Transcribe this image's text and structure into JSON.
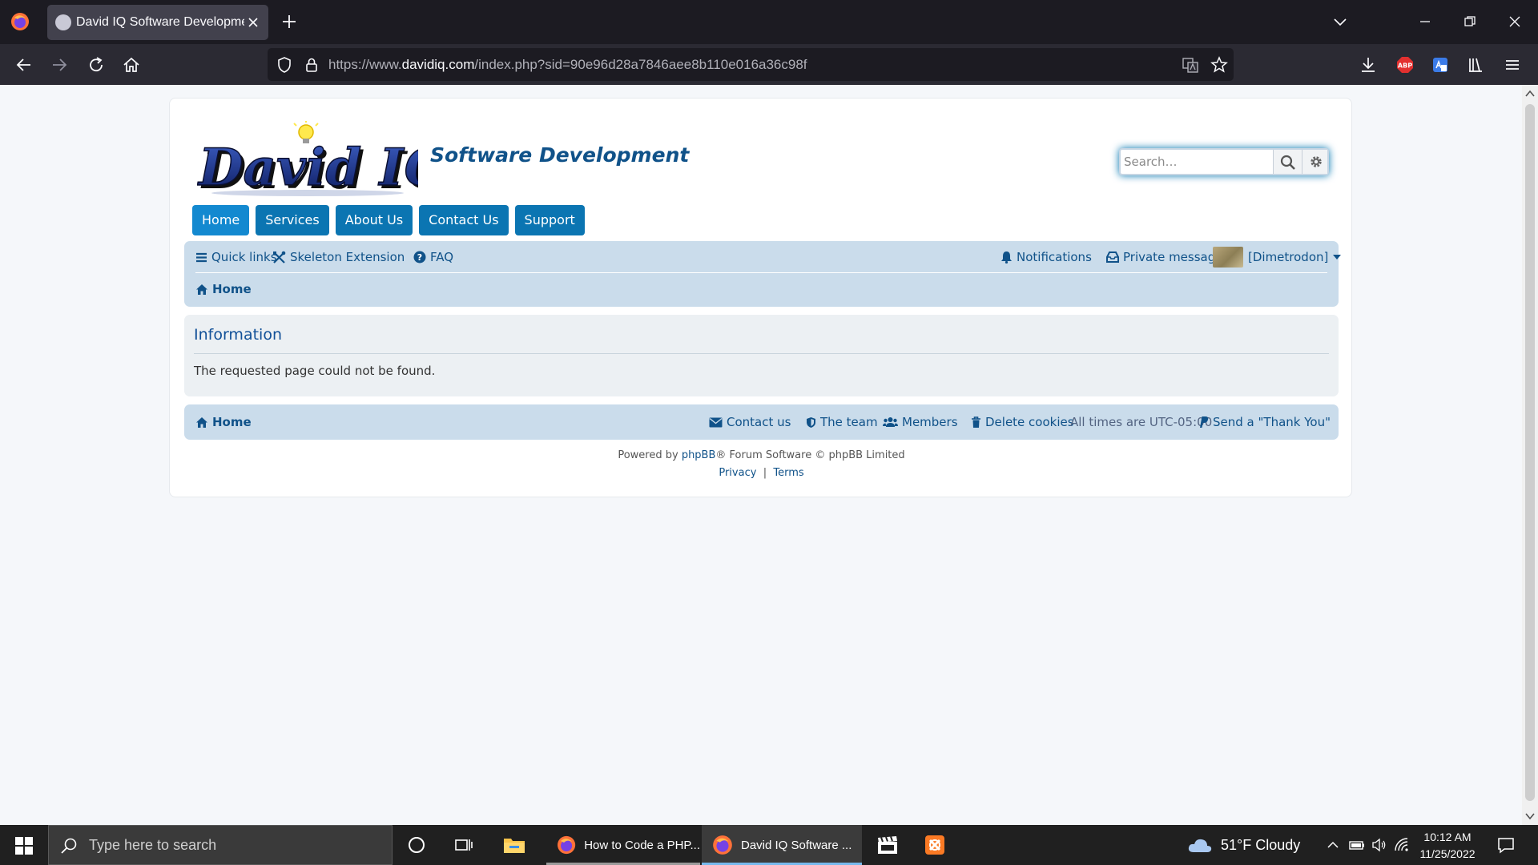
{
  "browser": {
    "tab_title": "David IQ Software Development",
    "url_prefix": "https://www.",
    "url_host": "davidiq.com",
    "url_path": "/index.php?sid=90e96d28a7846aee8b110e016a36c98f",
    "adblock_label": "ABP"
  },
  "site": {
    "logo_text": "David IQ",
    "tagline": "Software Development",
    "search_placeholder": "Search…"
  },
  "mainnav": [
    "Home",
    "Services",
    "About Us",
    "Contact Us",
    "Support"
  ],
  "phpnav": {
    "quick_links": "Quick links",
    "skeleton_extension": "Skeleton Extension",
    "faq": "FAQ",
    "notifications": "Notifications",
    "private_messages": "Private messages",
    "username": "[Dimetrodon]",
    "breadcrumb_home": "Home"
  },
  "info": {
    "title": "Information",
    "message": "The requested page could not be found."
  },
  "footer": {
    "home": "Home",
    "contact_us": "Contact us",
    "the_team": "The team",
    "members": "Members",
    "delete_cookies": "Delete cookies",
    "timezone": "All times are UTC-05:00",
    "thank_you": "Send a \"Thank You\"",
    "powered_prefix": "Powered by ",
    "powered_link": "phpBB",
    "powered_suffix": "® Forum Software © phpBB Limited",
    "privacy": "Privacy",
    "separator": "|",
    "terms": "Terms"
  },
  "taskbar": {
    "search_placeholder": "Type here to search",
    "app1_label": "How to Code a PHP...",
    "app2_label": "David IQ Software ...",
    "weather": "51°F  Cloudy",
    "time": "10:12 AM",
    "date": "11/25/2022"
  },
  "colors": {
    "phpbb_blue": "#105289",
    "nav_button": "#0b75b2",
    "navbar_bg": "#cadceb",
    "panel_bg": "#ecf0f3"
  }
}
